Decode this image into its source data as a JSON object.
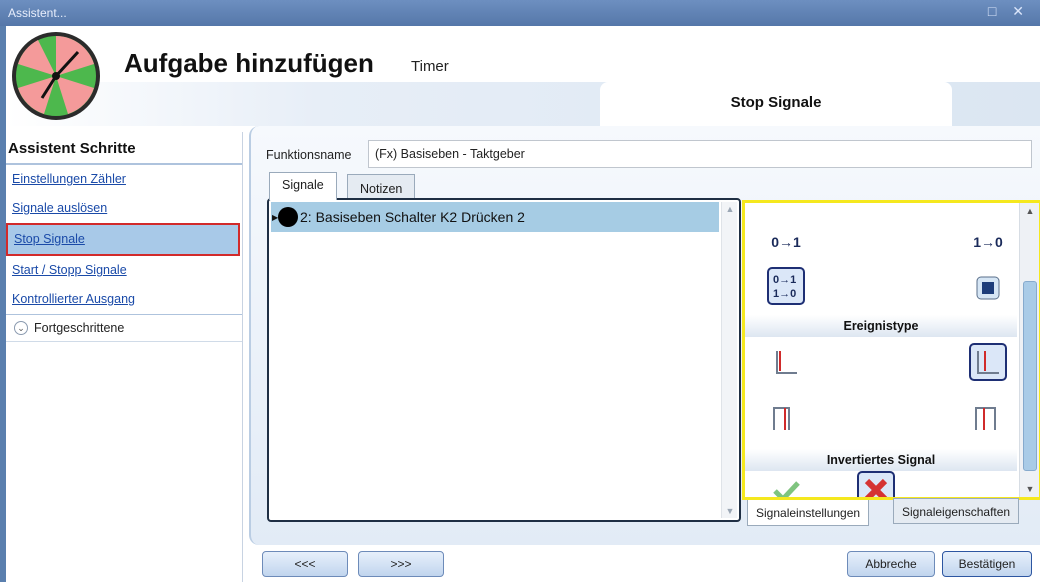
{
  "window": {
    "title": "Assistent...",
    "controls": "□ ✕"
  },
  "header": {
    "title": "Aufgabe hinzufügen",
    "subtitle": "Timer",
    "tab_label": "Stop Signale"
  },
  "sidebar": {
    "heading": "Assistent Schritte",
    "items": [
      {
        "label": "Einstellungen Zähler"
      },
      {
        "label": "Signale auslösen"
      },
      {
        "label": "Stop Signale"
      },
      {
        "label": "Start / Stopp Signale"
      },
      {
        "label": "Kontrollierter Ausgang"
      }
    ],
    "advanced_label": "Fortgeschrittene"
  },
  "form": {
    "function_name_label": "Funktionsname",
    "function_name_value": "(Fx) Basiseben - Taktgeber"
  },
  "tabs": [
    "Signale",
    "Notizen"
  ],
  "signals": [
    {
      "label": "2: Basiseben Schalter K2 Drücken 2"
    }
  ],
  "properties": {
    "event_buttons": [
      "0→1",
      "1→0"
    ],
    "event_type_label": "Ereignistype",
    "inverted_label": "Invertiertes Signal"
  },
  "bottom_tabs": [
    "Signaleinstellungen",
    "Signaleigenschaften"
  ],
  "footer": {
    "prev": "<<<",
    "next": ">>>",
    "cancel": "Abbreche",
    "confirm": "Bestätigen"
  }
}
